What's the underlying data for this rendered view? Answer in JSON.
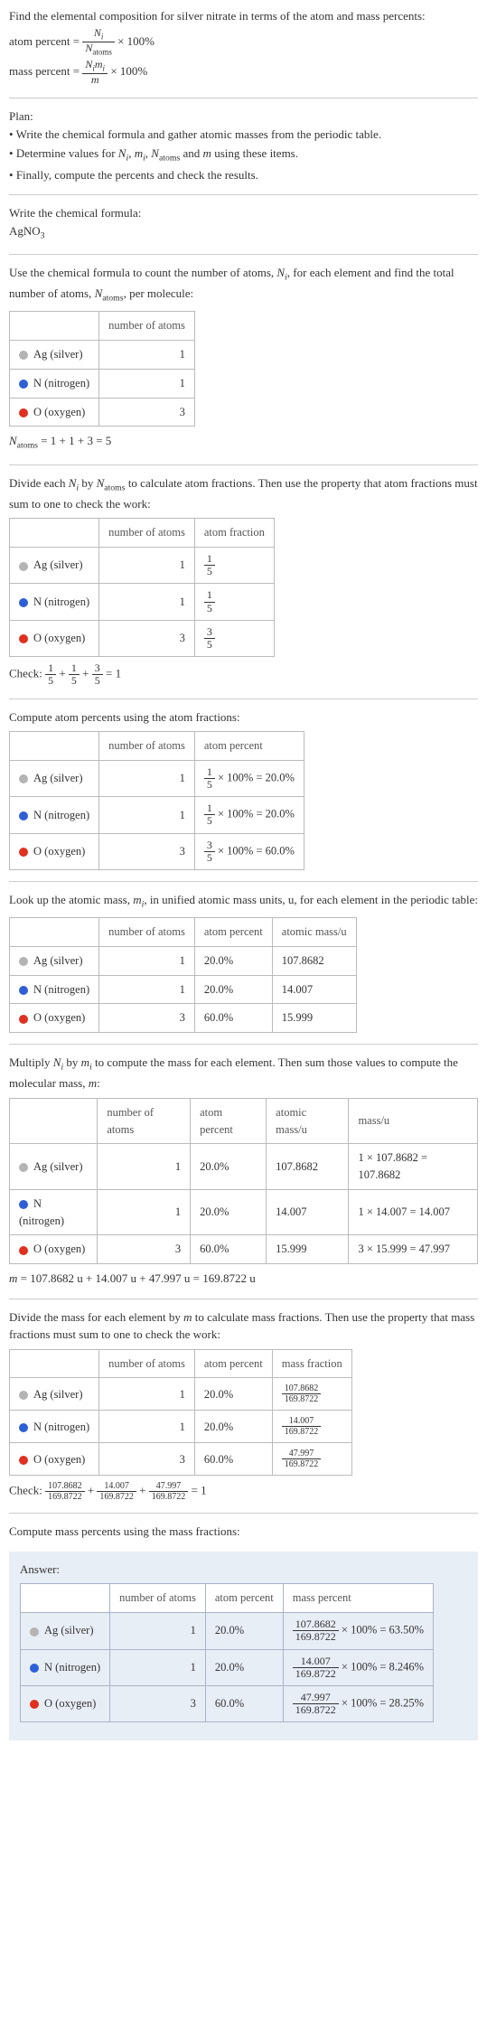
{
  "intro": {
    "line1": "Find the elemental composition for silver nitrate in terms of the atom and mass percents:",
    "atom_percent_lhs": "atom percent =",
    "atom_percent_num": "N",
    "atom_percent_num_sub": "i",
    "atom_percent_den": "N",
    "atom_percent_den_sub": "atoms",
    "times100": "× 100%",
    "mass_percent_lhs": "mass percent =",
    "mass_percent_num_a": "N",
    "mass_percent_num_a_sub": "i",
    "mass_percent_num_b": "m",
    "mass_percent_num_b_sub": "i",
    "mass_percent_den": "m"
  },
  "plan": {
    "heading": "Plan:",
    "item1": "Write the chemical formula and gather atomic masses from the periodic table.",
    "item2_pre": "Determine values for ",
    "item2_post": " using these items.",
    "item3": "Finally, compute the percents and check the results."
  },
  "write_formula": {
    "heading": "Write the chemical formula:",
    "formula_main": "AgNO",
    "formula_sub": "3"
  },
  "count_atoms": {
    "intro_pre": "Use the chemical formula to count the number of atoms, ",
    "intro_mid": ", for each element and find the total number of atoms, ",
    "intro_post": ", per molecule:",
    "col1": "number of atoms",
    "rows": [
      {
        "el": "Ag (silver)",
        "sw": "sw-ag",
        "n": "1"
      },
      {
        "el": "N (nitrogen)",
        "sw": "sw-n",
        "n": "1"
      },
      {
        "el": "O (oxygen)",
        "sw": "sw-o",
        "n": "3"
      }
    ],
    "sum_eq": " = 1 + 1 + 3 = 5"
  },
  "atom_fractions": {
    "intro": "Divide each Nᵢ by N",
    "intro_sub": "atoms",
    "intro_rest": " to calculate atom fractions. Then use the property that atom fractions must sum to one to check the work:",
    "col1": "number of atoms",
    "col2": "atom fraction",
    "rows": [
      {
        "el": "Ag (silver)",
        "sw": "sw-ag",
        "n": "1",
        "num": "1",
        "den": "5"
      },
      {
        "el": "N (nitrogen)",
        "sw": "sw-n",
        "n": "1",
        "num": "1",
        "den": "5"
      },
      {
        "el": "O (oxygen)",
        "sw": "sw-o",
        "n": "3",
        "num": "3",
        "den": "5"
      }
    ],
    "check_label": "Check: ",
    "check_eq": " = 1"
  },
  "atom_percents": {
    "intro": "Compute atom percents using the atom fractions:",
    "col1": "number of atoms",
    "col2": "atom percent",
    "rows": [
      {
        "el": "Ag (silver)",
        "sw": "sw-ag",
        "n": "1",
        "num": "1",
        "den": "5",
        "res": " × 100% = 20.0%"
      },
      {
        "el": "N (nitrogen)",
        "sw": "sw-n",
        "n": "1",
        "num": "1",
        "den": "5",
        "res": " × 100% = 20.0%"
      },
      {
        "el": "O (oxygen)",
        "sw": "sw-o",
        "n": "3",
        "num": "3",
        "den": "5",
        "res": " × 100% = 60.0%"
      }
    ]
  },
  "atomic_mass": {
    "intro_pre": "Look up the atomic mass, ",
    "intro_post": ", in unified atomic mass units, u, for each element in the periodic table:",
    "col1": "number of atoms",
    "col2": "atom percent",
    "col3": "atomic mass/u",
    "rows": [
      {
        "el": "Ag (silver)",
        "sw": "sw-ag",
        "n": "1",
        "ap": "20.0%",
        "am": "107.8682"
      },
      {
        "el": "N (nitrogen)",
        "sw": "sw-n",
        "n": "1",
        "ap": "20.0%",
        "am": "14.007"
      },
      {
        "el": "O (oxygen)",
        "sw": "sw-o",
        "n": "3",
        "ap": "60.0%",
        "am": "15.999"
      }
    ]
  },
  "mass_calc": {
    "intro_pre": "Multiply ",
    "intro_mid": " by ",
    "intro_post": " to compute the mass for each element. Then sum those values to compute the molecular mass, ",
    "intro_end": ":",
    "col1": "number of atoms",
    "col2": "atom percent",
    "col3": "atomic mass/u",
    "col4": "mass/u",
    "rows": [
      {
        "el": "Ag (silver)",
        "sw": "sw-ag",
        "n": "1",
        "ap": "20.0%",
        "am": "107.8682",
        "mass": "1 × 107.8682 = 107.8682"
      },
      {
        "el": "N (nitrogen)",
        "sw": "sw-n",
        "n": "1",
        "ap": "20.0%",
        "am": "14.007",
        "mass": "1 × 14.007 = 14.007"
      },
      {
        "el": "O (oxygen)",
        "sw": "sw-o",
        "n": "3",
        "ap": "60.0%",
        "am": "15.999",
        "mass": "3 × 15.999 = 47.997"
      }
    ],
    "sum_eq": " = 107.8682 u + 14.007 u + 47.997 u = 169.8722 u"
  },
  "mass_fractions": {
    "intro": "Divide the mass for each element by m to calculate mass fractions. Then use the property that mass fractions must sum to one to check the work:",
    "col1": "number of atoms",
    "col2": "atom percent",
    "col3": "mass fraction",
    "rows": [
      {
        "el": "Ag (silver)",
        "sw": "sw-ag",
        "n": "1",
        "ap": "20.0%",
        "num": "107.8682",
        "den": "169.8722"
      },
      {
        "el": "N (nitrogen)",
        "sw": "sw-n",
        "n": "1",
        "ap": "20.0%",
        "num": "14.007",
        "den": "169.8722"
      },
      {
        "el": "O (oxygen)",
        "sw": "sw-o",
        "n": "3",
        "ap": "60.0%",
        "num": "47.997",
        "den": "169.8722"
      }
    ],
    "check_label": "Check: ",
    "check_eq": " = 1"
  },
  "mass_percents": {
    "intro": "Compute mass percents using the mass fractions:"
  },
  "answer": {
    "heading": "Answer:",
    "col1": "number of atoms",
    "col2": "atom percent",
    "col3": "mass percent",
    "rows": [
      {
        "el": "Ag (silver)",
        "sw": "sw-ag",
        "n": "1",
        "ap": "20.0%",
        "num": "107.8682",
        "den": "169.8722",
        "res": "× 100% = 63.50%"
      },
      {
        "el": "N (nitrogen)",
        "sw": "sw-n",
        "n": "1",
        "ap": "20.0%",
        "num": "14.007",
        "den": "169.8722",
        "res": "× 100% = 8.246%"
      },
      {
        "el": "O (oxygen)",
        "sw": "sw-o",
        "n": "3",
        "ap": "60.0%",
        "num": "47.997",
        "den": "169.8722",
        "res": "× 100% = 28.25%"
      }
    ]
  }
}
